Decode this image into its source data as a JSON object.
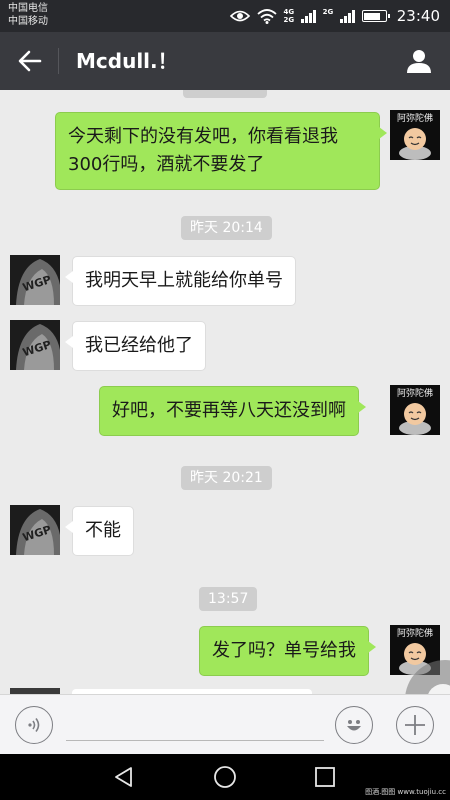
{
  "status_bar": {
    "carrier_1": "中国电信",
    "carrier_2": "中国移动",
    "net_1_top": "4G",
    "net_1_bottom": "2G",
    "net_2": "2G",
    "battery_percent": 80,
    "time": "23:40"
  },
  "header": {
    "title": "Mcdull.！"
  },
  "messages": [
    {
      "side": "right",
      "type": "text",
      "text": "今天剩下的没有发吧，你看看退我300行吗，酒就不要发了"
    },
    {
      "type": "time",
      "text": "昨天 20:14"
    },
    {
      "side": "left",
      "type": "text",
      "text": "我明天早上就能给你单号"
    },
    {
      "side": "left",
      "type": "text",
      "text": "我已经给他了"
    },
    {
      "side": "right",
      "type": "text",
      "text": "好吧，不要再等八天还没到啊"
    },
    {
      "type": "time",
      "text": "昨天 20:21"
    },
    {
      "side": "left",
      "type": "text",
      "text": "不能"
    },
    {
      "type": "time",
      "text": "13:57"
    },
    {
      "side": "right",
      "type": "text",
      "text": "发了吗？单号给我"
    }
  ],
  "avatars": {
    "self_logo_text": "阿弥陀佛",
    "other_logo_text": "WGP"
  },
  "input_bar": {
    "placeholder": ""
  },
  "watermark": "图酒.图图 www.tuojiu.cc",
  "icons": {
    "back": "arrow-left-icon",
    "profile": "person-icon",
    "voice": "voice-icon",
    "emoji": "smiley-icon",
    "plus": "plus-icon",
    "nav_back": "triangle-back-icon",
    "nav_home": "circle-home-icon",
    "nav_recent": "square-recent-icon"
  },
  "colors": {
    "header_bg": "#393a3f",
    "status_bg": "#28292d",
    "sent_bubble": "#a0e75a",
    "received_bubble": "#ffffff",
    "chat_bg": "#ebebeb"
  }
}
